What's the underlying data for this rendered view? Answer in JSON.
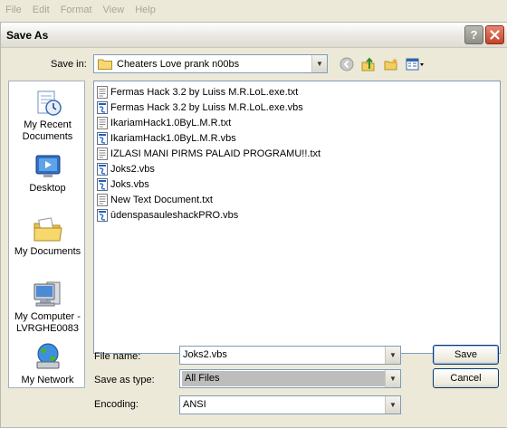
{
  "menubar": {
    "items": [
      "File",
      "Edit",
      "Format",
      "View",
      "Help"
    ]
  },
  "dialog": {
    "title": "Save As",
    "help_icon": "question-icon",
    "close_icon": "close-icon"
  },
  "save_in": {
    "label": "Save in:",
    "value": "Cheaters Love prank n00bs"
  },
  "toolbar": {
    "icons": [
      "back-icon",
      "up-folder-icon",
      "new-folder-icon",
      "views-menu-icon"
    ]
  },
  "places": [
    {
      "label": "My Recent Documents",
      "icon": "recent-documents-icon"
    },
    {
      "label": "Desktop",
      "icon": "desktop-icon"
    },
    {
      "label": "My Documents",
      "icon": "my-documents-icon"
    },
    {
      "label": "My Computer - LVRGHE0083",
      "icon": "my-computer-icon"
    },
    {
      "label": "My Network",
      "icon": "my-network-icon"
    }
  ],
  "files": [
    {
      "name": "Fermas Hack 3.2 by Luiss M.R.LoL.exe.txt",
      "type": "txt"
    },
    {
      "name": "Fermas Hack 3.2 by Luiss M.R.LoL.exe.vbs",
      "type": "vbs"
    },
    {
      "name": "IkariamHack1.0ByL.M.R.txt",
      "type": "txt"
    },
    {
      "name": "IkariamHack1.0ByL.M.R.vbs",
      "type": "vbs"
    },
    {
      "name": "IZLASI MANI PIRMS PALAID PROGRAMU!!.txt",
      "type": "txt"
    },
    {
      "name": "Joks2.vbs",
      "type": "vbs"
    },
    {
      "name": "Joks.vbs",
      "type": "vbs"
    },
    {
      "name": "New Text Document.txt",
      "type": "txt"
    },
    {
      "name": "ūdenspasauleshackPRO.vbs",
      "type": "vbs"
    }
  ],
  "form": {
    "file_name_label": "File name:",
    "file_name_value": "Joks2.vbs",
    "save_as_type_label": "Save as type:",
    "save_as_type_value": "All Files",
    "encoding_label": "Encoding:",
    "encoding_value": "ANSI"
  },
  "buttons": {
    "save": "Save",
    "cancel": "Cancel"
  }
}
